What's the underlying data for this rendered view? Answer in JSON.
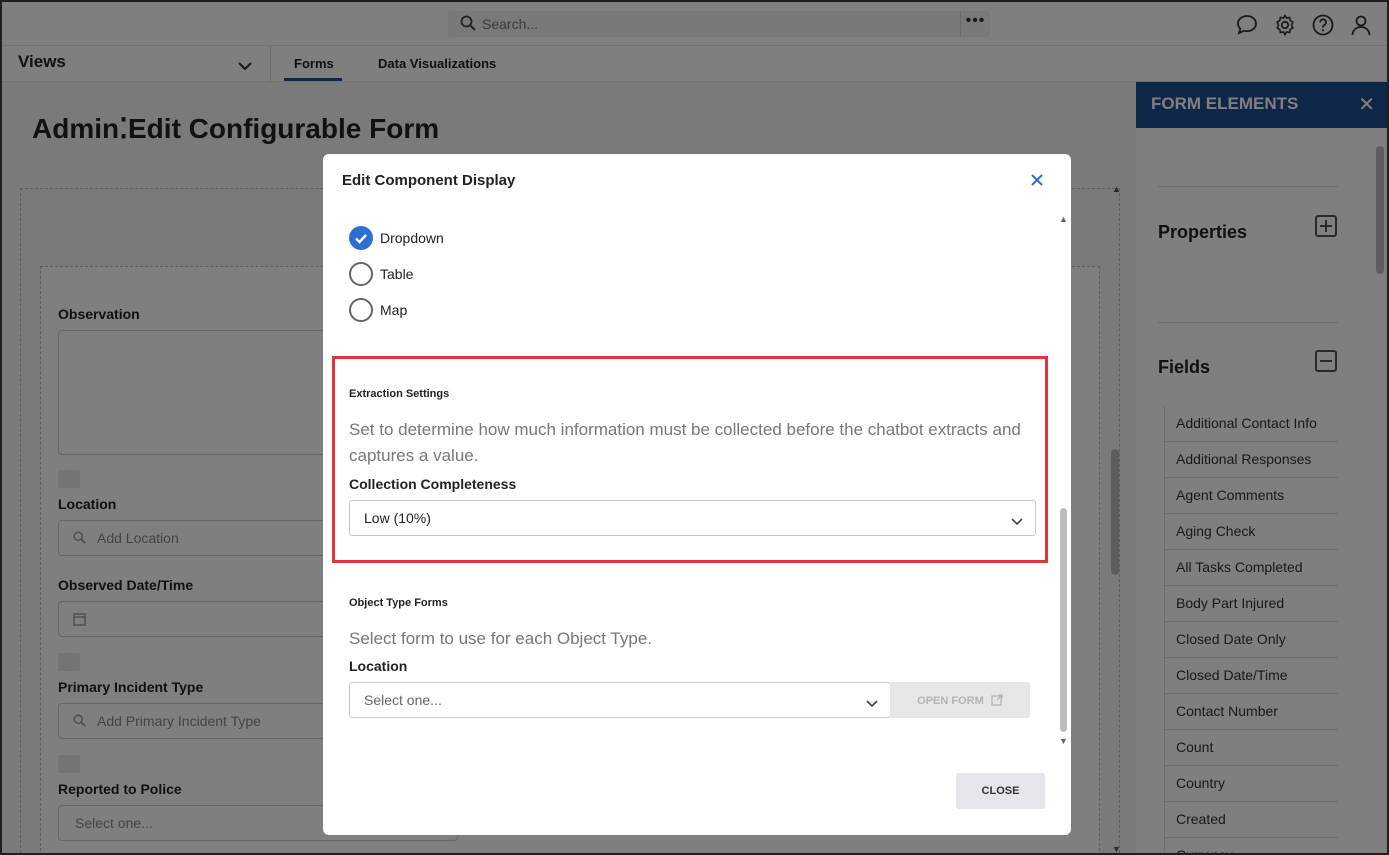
{
  "header": {
    "search_placeholder": "Search...",
    "more_label": "•••",
    "icons": [
      "chat-icon",
      "gear-icon",
      "help-icon",
      "user-icon"
    ]
  },
  "nav": {
    "views_label": "Views",
    "tabs": [
      {
        "label": "Forms",
        "active": true
      },
      {
        "label": "Data Visualizations",
        "active": false
      }
    ]
  },
  "page": {
    "title": "Admin⁚Edit Configurable Form",
    "fields": [
      {
        "label": "Observation"
      },
      {
        "label": "Location",
        "placeholder": "Add Location"
      },
      {
        "label": "Observed Date/Time"
      },
      {
        "label": "Primary Incident Type",
        "placeholder": "Add Primary Incident Type"
      },
      {
        "label": "Reported to Police",
        "placeholder": "Select one..."
      }
    ]
  },
  "right_panel": {
    "title": "FORM ELEMENTS",
    "close_label": "✕",
    "properties_label": "Properties",
    "fields_label": "Fields",
    "field_items": [
      "Additional Contact Info",
      "Additional Responses",
      "Agent Comments",
      "Aging Check",
      "All Tasks Completed",
      "Body Part Injured",
      "Closed Date Only",
      "Closed Date/Time",
      "Contact Number",
      "Count",
      "Country",
      "Created",
      "Currency"
    ]
  },
  "modal": {
    "title": "Edit Component Display",
    "display_options": [
      {
        "label": "Dropdown",
        "checked": true
      },
      {
        "label": "Table",
        "checked": false
      },
      {
        "label": "Map",
        "checked": false
      }
    ],
    "extraction": {
      "title": "Extraction Settings",
      "description": "Set to determine how much information must be collected before the chatbot extracts and captures a value.",
      "field_label": "Collection Completeness",
      "selected_value": "Low (10%)"
    },
    "object_type": {
      "title": "Object Type Forms",
      "description": "Select form to use for each Object Type.",
      "field_label": "Location",
      "placeholder": "Select one...",
      "open_form_label": "OPEN FORM"
    },
    "close_label": "CLOSE"
  },
  "colors": {
    "accent": "#1f4e8c",
    "radio_checked": "#2c6fd1",
    "highlight": "#e0363b",
    "close_x": "#2c6fd1"
  }
}
